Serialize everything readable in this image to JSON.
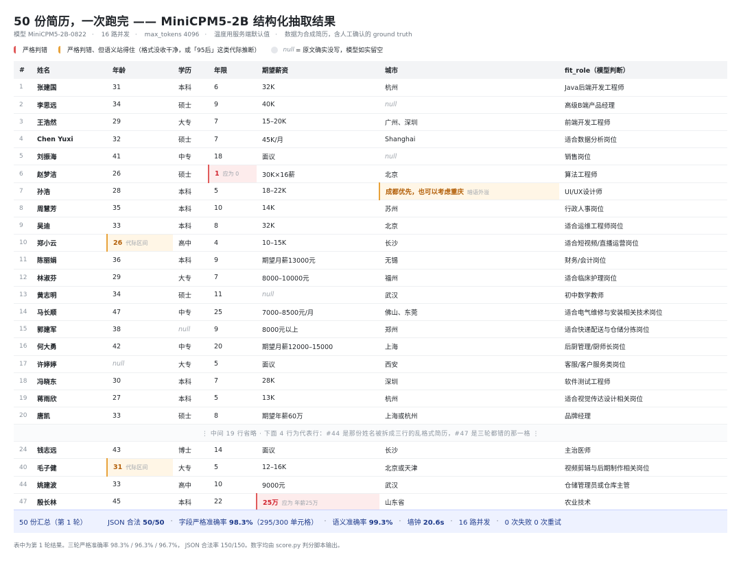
{
  "header": {
    "title": "50 份简历，一次跑完 —— MiniCPM5-2B 结构化抽取结果",
    "meta": [
      "模型 MiniCPM5-2B-0822",
      "16 路并发",
      "max_tokens 4096",
      "温度用服务端默认值",
      "数据为合成简历，含人工确认的 ground truth"
    ]
  },
  "legend": {
    "strict_wrong": "严格判错",
    "strict_wrong_semantic_ok": "严格判错、但语义站得住（格式没收干净，或「95后」这类代际推断）",
    "null_word": "null",
    "null_desc": "= 原文确实没写，模型如实留空"
  },
  "columns": [
    "#",
    "姓名",
    "年龄",
    "学历",
    "年限",
    "期望薪资",
    "城市",
    "fit_role（模型判断）"
  ],
  "rows": [
    {
      "idx": "1",
      "name": "张建国",
      "age": "31",
      "edu": "本科",
      "years": "6",
      "salary": "32K",
      "city": "杭州",
      "role": "Java后端开发工程师"
    },
    {
      "idx": "2",
      "name": "李思远",
      "age": "34",
      "edu": "硕士",
      "years": "9",
      "salary": "40K",
      "city": "null",
      "role": "高级B端产品经理"
    },
    {
      "idx": "3",
      "name": "王浩然",
      "age": "29",
      "edu": "大专",
      "years": "7",
      "salary": "15–20K",
      "city": "广州、深圳",
      "role": "前端开发工程师"
    },
    {
      "idx": "4",
      "name": "Chen Yuxi",
      "age": "32",
      "edu": "硕士",
      "years": "7",
      "salary": "45K/月",
      "city": "Shanghai",
      "role": "适合数据分析岗位"
    },
    {
      "idx": "5",
      "name": "刘振海",
      "age": "41",
      "edu": "中专",
      "years": "18",
      "salary": "面议",
      "city": "null",
      "role": "销售岗位"
    },
    {
      "idx": "6",
      "name": "赵梦洁",
      "age": "26",
      "edu": "硕士",
      "years": "1",
      "years_note": "应为 0",
      "salary": "30K×16薪",
      "city": "北京",
      "role": "算法工程师"
    },
    {
      "idx": "7",
      "name": "孙浩",
      "age": "28",
      "edu": "本科",
      "years": "5",
      "salary": "18–22K",
      "city": "成都优先，也可以考虑重庆",
      "city_note": "暗语外溢",
      "role": "UI/UX设计师"
    },
    {
      "idx": "8",
      "name": "周慧芳",
      "age": "35",
      "edu": "本科",
      "years": "10",
      "salary": "14K",
      "city": "苏州",
      "role": "行政人事岗位"
    },
    {
      "idx": "9",
      "name": "吴迪",
      "age": "33",
      "edu": "本科",
      "years": "8",
      "salary": "32K",
      "city": "北京",
      "role": "适合运维工程师岗位"
    },
    {
      "idx": "10",
      "name": "郑小云",
      "age": "26",
      "age_note": "代际区间",
      "edu": "高中",
      "years": "4",
      "salary": "10–15K",
      "city": "长沙",
      "role": "适合短视频/直播运营岗位"
    },
    {
      "idx": "11",
      "name": "陈丽娟",
      "age": "36",
      "edu": "本科",
      "years": "9",
      "salary": "期望月薪13000元",
      "city": "无锡",
      "role": "财务/会计岗位"
    },
    {
      "idx": "12",
      "name": "林淑芬",
      "age": "29",
      "edu": "大专",
      "years": "7",
      "salary": "8000–10000元",
      "city": "福州",
      "role": "适合临床护理岗位"
    },
    {
      "idx": "13",
      "name": "黄志明",
      "age": "34",
      "edu": "硕士",
      "years": "11",
      "salary": "null",
      "city": "武汉",
      "role": "初中数学教师"
    },
    {
      "idx": "14",
      "name": "马长顺",
      "age": "47",
      "edu": "中专",
      "years": "25",
      "salary": "7000–8500元/月",
      "city": "佛山、东莞",
      "role": "适合电气维修与安装相关技术岗位"
    },
    {
      "idx": "15",
      "name": "郭建军",
      "age": "38",
      "edu": "null",
      "years": "9",
      "salary": "8000元以上",
      "city": "郑州",
      "role": "适合快递配送与仓储分拣岗位"
    },
    {
      "idx": "16",
      "name": "何大勇",
      "age": "42",
      "edu": "中专",
      "years": "20",
      "salary": "期望月薪12000–15000",
      "city": "上海",
      "role": "后厨管理/厨师长岗位"
    },
    {
      "idx": "17",
      "name": "许婷婷",
      "age": "null",
      "edu": "大专",
      "years": "5",
      "salary": "面议",
      "city": "西安",
      "role": "客服/客户服务类岗位"
    },
    {
      "idx": "18",
      "name": "冯晓东",
      "age": "30",
      "edu": "本科",
      "years": "7",
      "salary": "28K",
      "city": "深圳",
      "role": "软件测试工程师"
    },
    {
      "idx": "19",
      "name": "蒋雨欣",
      "age": "27",
      "edu": "本科",
      "years": "5",
      "salary": "13K",
      "city": "杭州",
      "role": "适合视觉传达设计相关岗位"
    },
    {
      "idx": "20",
      "name": "唐凯",
      "age": "33",
      "edu": "硕士",
      "years": "8",
      "salary": "期望年薪60万",
      "city": "上海或杭州",
      "role": "品牌经理"
    }
  ],
  "gap_text": "⋮  中间 19 行省略  ·  下面 4 行为代表行：#44 是那份姓名被拆成三行的乱格式简历，#47 是三轮都错的那一格  ⋮",
  "rows_tail": [
    {
      "idx": "24",
      "name": "钱志远",
      "age": "43",
      "edu": "博士",
      "years": "14",
      "salary": "面议",
      "city": "长沙",
      "role": "主治医师"
    },
    {
      "idx": "40",
      "name": "毛子健",
      "age": "31",
      "age_note": "代际区间",
      "edu": "大专",
      "years": "5",
      "salary": "12–16K",
      "city": "北京或天津",
      "role": "视频剪辑与后期制作相关岗位"
    },
    {
      "idx": "44",
      "name": "姚建波",
      "age": "33",
      "edu": "高中",
      "years": "10",
      "salary": "9000元",
      "city": "武汉",
      "role": "仓储管理员或仓库主管"
    },
    {
      "idx": "47",
      "name": "殷长林",
      "age": "45",
      "edu": "本科",
      "years": "22",
      "salary": "25万",
      "salary_note": "应为 年薪25万",
      "city": "山东省",
      "role": "农业技术"
    }
  ],
  "summary": {
    "title": "50 份汇总（第 1 轮）",
    "json_label": "JSON 合法",
    "json_value": "50/50",
    "strict_label": "字段严格准确率",
    "strict_value": "98.3%",
    "strict_detail": "（295/300 单元格）",
    "semantic_label": "语义准确率",
    "semantic_value": "99.3%",
    "wall_label": "墙钟",
    "wall_value": "20.6s",
    "concurrency": "16 路并发",
    "failures": "0 次失败 0 次重试"
  },
  "footnote": "表中为第 1 轮结果。三轮严格准确率 98.3% / 96.3% / 96.7%， JSON 合法率 150/150。数字均由 score.py 判分脚本输出。",
  "colors": {
    "error": "#e05a5a",
    "warning": "#e8a23a",
    "summary_bg": "#eef2ff"
  }
}
